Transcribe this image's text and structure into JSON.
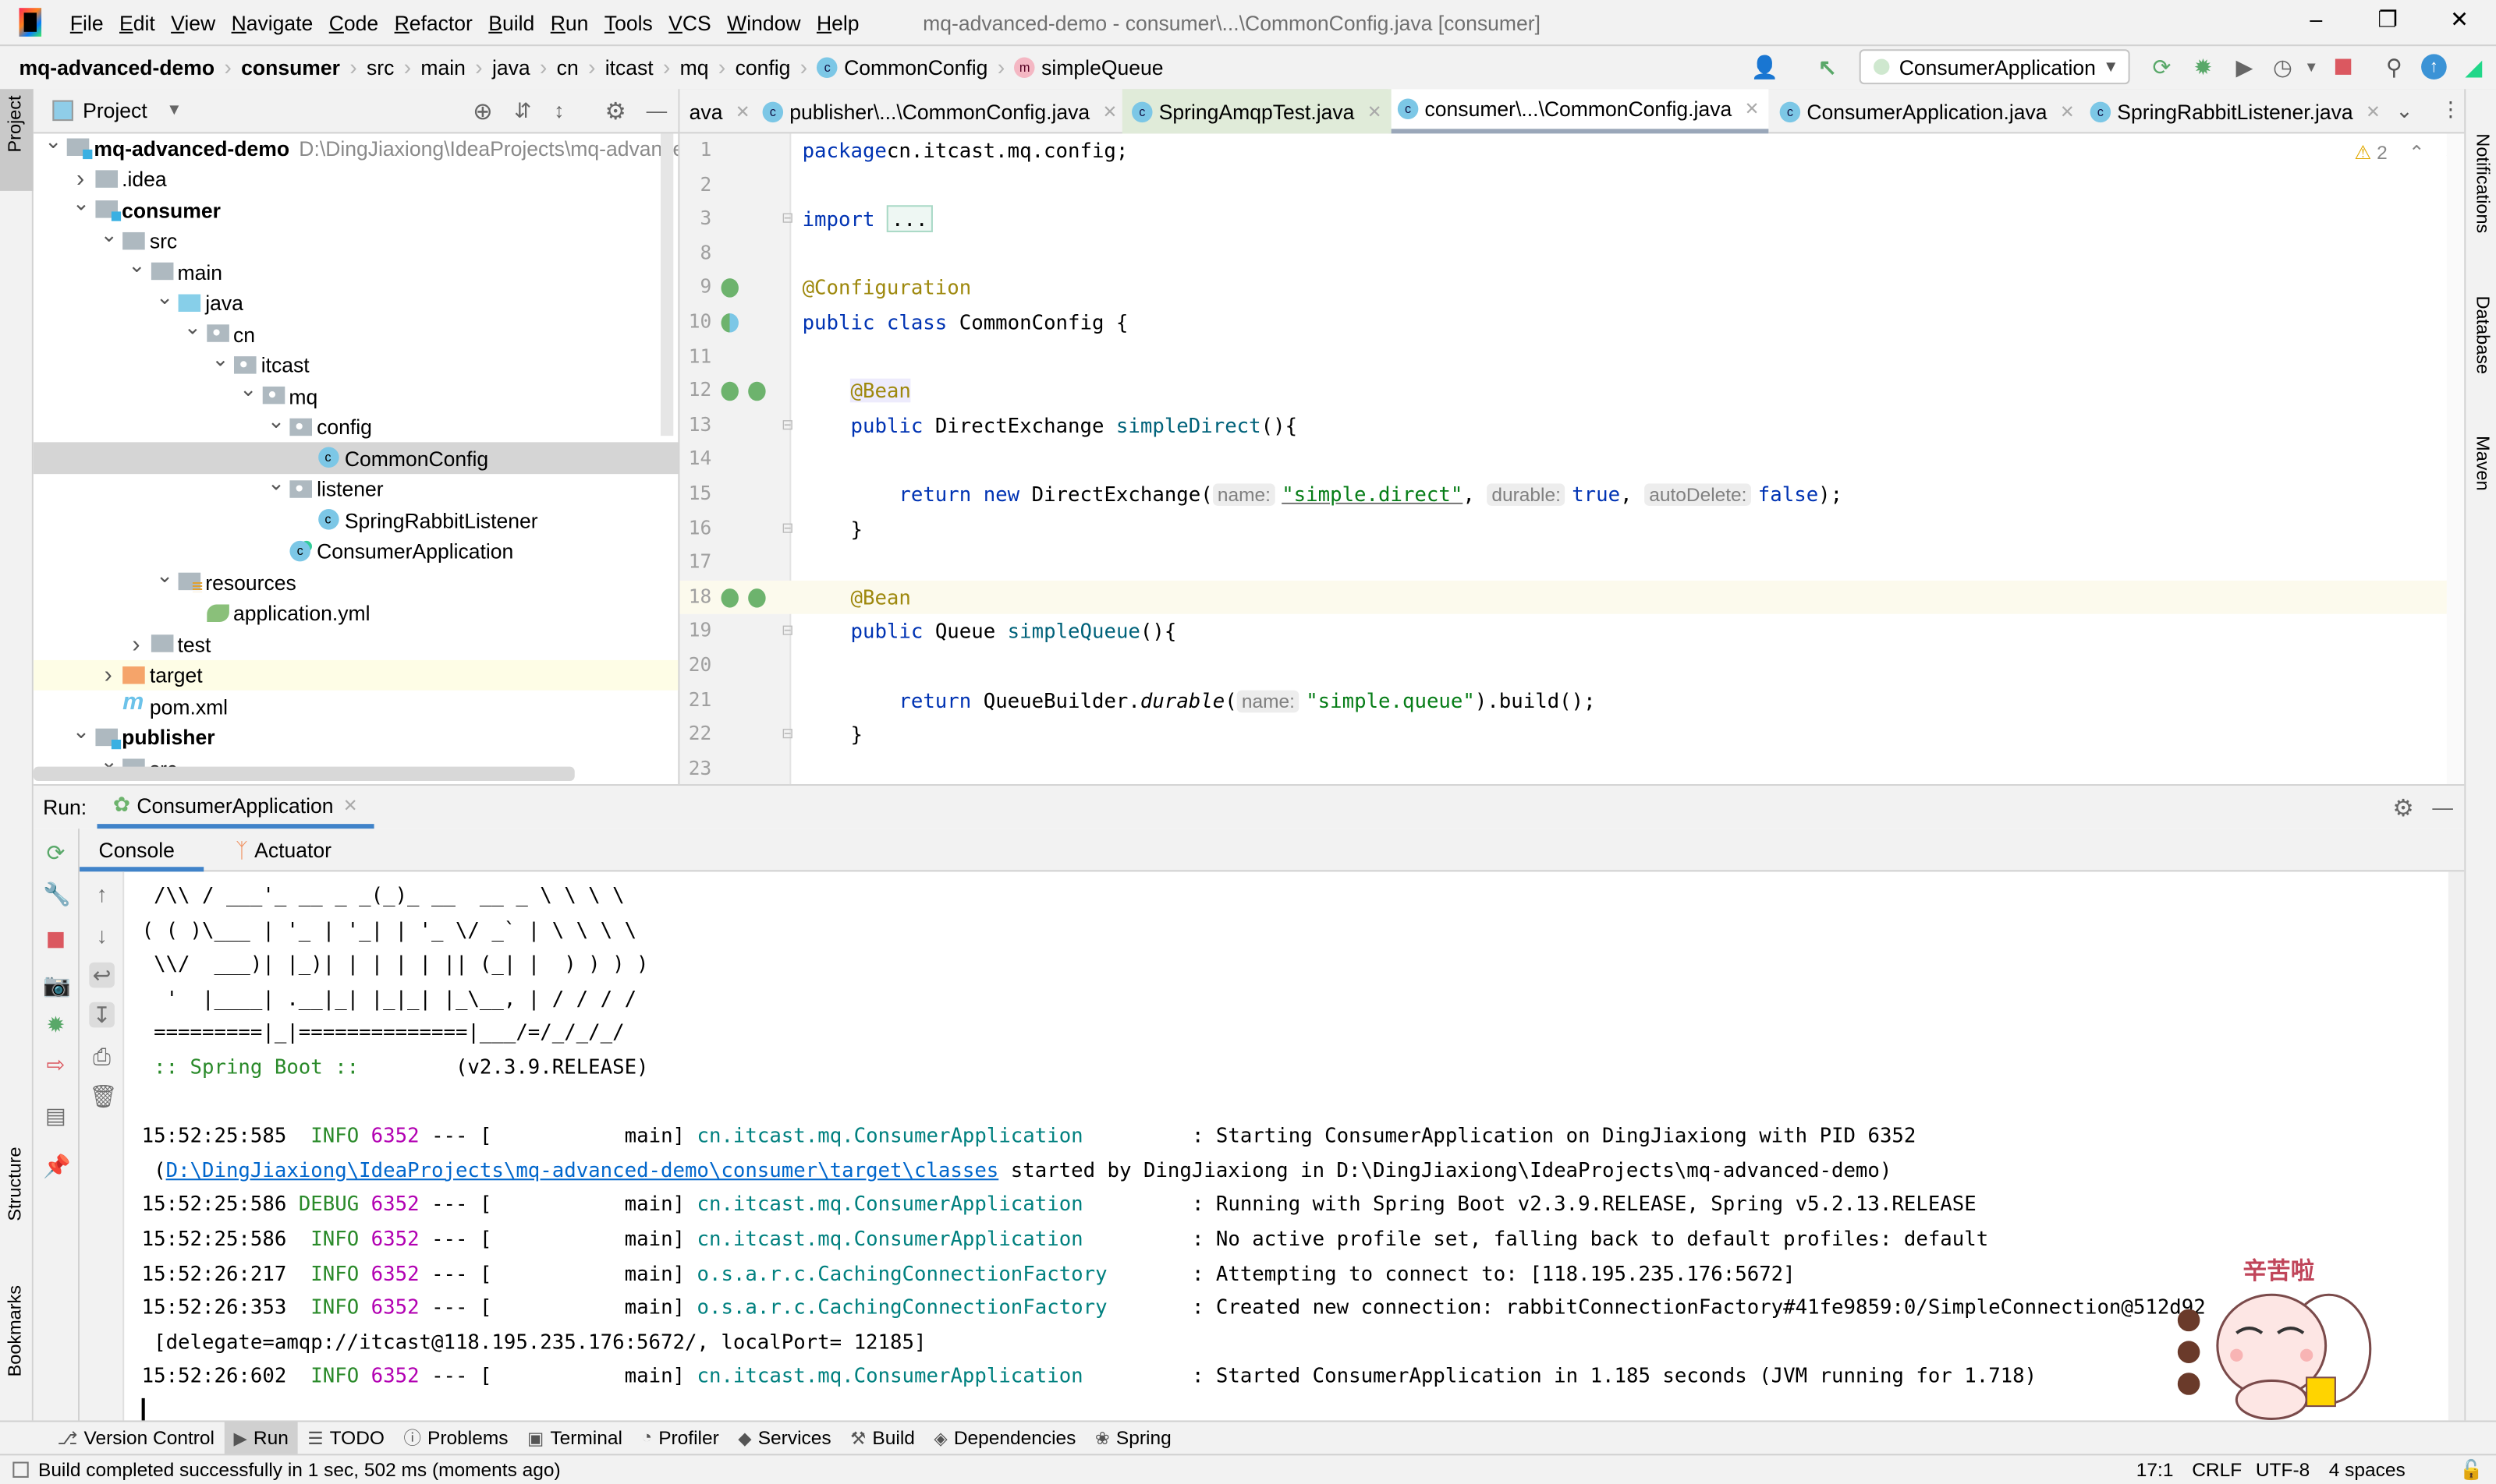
{
  "menu": {
    "items": [
      "File",
      "Edit",
      "View",
      "Navigate",
      "Code",
      "Refactor",
      "Build",
      "Run",
      "Tools",
      "VCS",
      "Window",
      "Help"
    ],
    "window_title": "mq-advanced-demo - consumer\\...\\CommonConfig.java [consumer]"
  },
  "breadcrumb": {
    "items": [
      "mq-advanced-demo",
      "consumer",
      "src",
      "main",
      "java",
      "cn",
      "itcast",
      "mq",
      "config"
    ],
    "class_item": "CommonConfig",
    "method_item": "simpleQueue"
  },
  "toolbar": {
    "run_config": "ConsumerApplication",
    "colors": {
      "stop": "#db5860",
      "run": "#59a869"
    }
  },
  "project": {
    "title": "Project",
    "tree": [
      {
        "label": "mq-advanced-demo",
        "path": "D:\\DingJiaxiong\\IdeaProjects\\mq-advanced-demo",
        "level": 0,
        "arrow": "expanded",
        "icon": "module",
        "bold": true
      },
      {
        "label": ".idea",
        "level": 1,
        "arrow": "collapsed",
        "icon": "folder"
      },
      {
        "label": "consumer",
        "level": 1,
        "arrow": "expanded",
        "icon": "module",
        "bold": true
      },
      {
        "label": "src",
        "level": 2,
        "arrow": "expanded",
        "icon": "folder"
      },
      {
        "label": "main",
        "level": 3,
        "arrow": "expanded",
        "icon": "folder"
      },
      {
        "label": "java",
        "level": 4,
        "arrow": "expanded",
        "icon": "java"
      },
      {
        "label": "cn",
        "level": 5,
        "arrow": "expanded",
        "icon": "pkg"
      },
      {
        "label": "itcast",
        "level": 6,
        "arrow": "expanded",
        "icon": "pkg"
      },
      {
        "label": "mq",
        "level": 7,
        "arrow": "expanded",
        "icon": "pkg"
      },
      {
        "label": "config",
        "level": 8,
        "arrow": "expanded",
        "icon": "pkg"
      },
      {
        "label": "CommonConfig",
        "level": 9,
        "arrow": "none",
        "icon": "class",
        "selected": true
      },
      {
        "label": "listener",
        "level": 8,
        "arrow": "expanded",
        "icon": "pkg"
      },
      {
        "label": "SpringRabbitListener",
        "level": 9,
        "arrow": "none",
        "icon": "class"
      },
      {
        "label": "ConsumerApplication",
        "level": 8,
        "arrow": "none",
        "icon": "spring"
      },
      {
        "label": "resources",
        "level": 4,
        "arrow": "expanded",
        "icon": "res"
      },
      {
        "label": "application.yml",
        "level": 5,
        "arrow": "none",
        "icon": "yml"
      },
      {
        "label": "test",
        "level": 3,
        "arrow": "collapsed",
        "icon": "folder"
      },
      {
        "label": "target",
        "level": 2,
        "arrow": "collapsed",
        "icon": "target",
        "highlight": true
      },
      {
        "label": "pom.xml",
        "level": 2,
        "arrow": "none",
        "icon": "maven"
      },
      {
        "label": "publisher",
        "level": 1,
        "arrow": "expanded",
        "icon": "module",
        "bold": true
      },
      {
        "label": "src",
        "level": 2,
        "arrow": "expanded",
        "icon": "folder"
      }
    ]
  },
  "editor": {
    "tabs": [
      {
        "label": "ava",
        "icon": "none"
      },
      {
        "label": "publisher\\...\\CommonConfig.java",
        "icon": "class"
      },
      {
        "label": "SpringAmqpTest.java",
        "icon": "test-class",
        "state": "green"
      },
      {
        "label": "consumer\\...\\CommonConfig.java",
        "icon": "class",
        "state": "active"
      },
      {
        "label": "ConsumerApplication.java",
        "icon": "spring-class"
      },
      {
        "label": "SpringRabbitListener.java",
        "icon": "class"
      }
    ],
    "warnings": "2",
    "caret_line": "18",
    "lines": [
      {
        "n": "1",
        "t": [
          [
            "kw",
            "package"
          ],
          [
            "",
            "cn.itcast.mq.config;"
          ]
        ]
      },
      {
        "n": "2",
        "t": []
      },
      {
        "n": "3",
        "t": [
          [
            "kw",
            "import "
          ],
          [
            "fold",
            "..."
          ]
        ],
        "fold": true
      },
      {
        "n": "8",
        "t": []
      },
      {
        "n": "9",
        "t": [
          [
            "ann",
            "@Configuration"
          ]
        ],
        "gutter": [
          "bean"
        ]
      },
      {
        "n": "10",
        "t": [
          [
            "kw",
            "public class "
          ],
          [
            "",
            "CommonConfig {"
          ]
        ],
        "gutter": [
          "class"
        ]
      },
      {
        "n": "11",
        "t": []
      },
      {
        "n": "12",
        "t": [
          [
            "",
            "    "
          ],
          [
            "ann annbg",
            "@Bean"
          ]
        ],
        "gutter": [
          "bean",
          "bean"
        ]
      },
      {
        "n": "13",
        "t": [
          [
            "",
            "    "
          ],
          [
            "kw",
            "public "
          ],
          [
            "",
            "DirectExchange "
          ],
          [
            "fn",
            "simpleDirect"
          ],
          [
            "",
            "(){"
          ]
        ],
        "fold": true
      },
      {
        "n": "14",
        "t": []
      },
      {
        "n": "15",
        "t": [
          [
            "",
            "        "
          ],
          [
            "kw",
            "return new "
          ],
          [
            "",
            "DirectExchange("
          ],
          [
            "hint",
            "name:"
          ],
          [
            "str ul",
            "\"simple.direct\""
          ],
          [
            "",
            ", "
          ],
          [
            "hint",
            "durable:"
          ],
          [
            "kw",
            "true"
          ],
          [
            "",
            ", "
          ],
          [
            "hint",
            "autoDelete:"
          ],
          [
            "kw",
            "false"
          ],
          [
            "",
            ");"
          ]
        ]
      },
      {
        "n": "16",
        "t": [
          [
            "",
            "    }"
          ]
        ],
        "fold": true
      },
      {
        "n": "17",
        "t": []
      },
      {
        "n": "18",
        "t": [
          [
            "",
            "    "
          ],
          [
            "ann",
            "@Bean"
          ]
        ],
        "gutter": [
          "bean",
          "bean"
        ]
      },
      {
        "n": "19",
        "t": [
          [
            "",
            "    "
          ],
          [
            "kw",
            "public "
          ],
          [
            "",
            "Queue "
          ],
          [
            "fn",
            "simpleQueue"
          ],
          [
            "",
            "(){"
          ]
        ],
        "fold": true
      },
      {
        "n": "20",
        "t": []
      },
      {
        "n": "21",
        "t": [
          [
            "",
            "        "
          ],
          [
            "kw",
            "return "
          ],
          [
            "",
            "QueueBuilder."
          ],
          [
            "it",
            "durable"
          ],
          [
            "",
            "("
          ],
          [
            "hint",
            "name:"
          ],
          [
            "str",
            "\"simple.queue\""
          ],
          [
            "",
            ").build();"
          ]
        ]
      },
      {
        "n": "22",
        "t": [
          [
            "",
            "    }"
          ]
        ],
        "fold": true
      },
      {
        "n": "23",
        "t": []
      }
    ]
  },
  "run": {
    "label": "Run:",
    "tab": "ConsumerApplication",
    "console_tabs": [
      "Console",
      "Actuator"
    ],
    "banner": [
      " /\\\\ / ___'_ __ _ _(_)_ __  __ _ \\ \\ \\ \\",
      "( ( )\\___ | '_ | '_| | '_ \\/ _` | \\ \\ \\ \\",
      " \\\\/  ___)| |_)| | | | | || (_| |  ) ) ) )",
      "  '  |____| .__|_| |_|_| |_\\__, | / / / /",
      " =========|_|==============|___/=/_/_/_/"
    ],
    "boot_label": " :: Spring Boot :: ",
    "boot_version": "       (v2.3.9.RELEASE)",
    "separator": "---",
    "logs": [
      {
        "time": "15:52:25:585",
        "level": "INFO",
        "pid": "6352",
        "thread": "main",
        "logger": "cn.itcast.mq.ConsumerApplication",
        "msg": "Starting ConsumerApplication on DingJiaxiong with PID 6352",
        "cont": {
          "prefix": " (",
          "link": "D:\\DingJiaxiong\\IdeaProjects\\mq-advanced-demo\\consumer\\target\\classes",
          "suffix": " started by DingJiaxiong in D:\\DingJiaxiong\\IdeaProjects\\mq-advanced-demo)"
        }
      },
      {
        "time": "15:52:25:586",
        "level": "DEBUG",
        "pid": "6352",
        "thread": "main",
        "logger": "cn.itcast.mq.ConsumerApplication",
        "msg": "Running with Spring Boot v2.3.9.RELEASE, Spring v5.2.13.RELEASE"
      },
      {
        "time": "15:52:25:586",
        "level": "INFO",
        "pid": "6352",
        "thread": "main",
        "logger": "cn.itcast.mq.ConsumerApplication",
        "msg": "No active profile set, falling back to default profiles: default"
      },
      {
        "time": "15:52:26:217",
        "level": "INFO",
        "pid": "6352",
        "thread": "main",
        "logger": "o.s.a.r.c.CachingConnectionFactory",
        "msg": "Attempting to connect to: [118.195.235.176:5672]"
      },
      {
        "time": "15:52:26:353",
        "level": "INFO",
        "pid": "6352",
        "thread": "main",
        "logger": "o.s.a.r.c.CachingConnectionFactory",
        "msg": "Created new connection: rabbitConnectionFactory#41fe9859:0/SimpleConnection@512d92",
        "cont": {
          "prefix": " [delegate=amqp://itcast@118.195.235.176:5672/, localPort= 12185]",
          "link": "",
          "suffix": ""
        }
      },
      {
        "time": "15:52:26:602",
        "level": "INFO",
        "pid": "6352",
        "thread": "main",
        "logger": "cn.itcast.mq.ConsumerApplication",
        "msg": "Started ConsumerApplication in 1.185 seconds (JVM running for 1.718)"
      }
    ],
    "colors": {
      "level": "#2a8a2a",
      "pid": "#b200b2",
      "logger": "#00807f",
      "link": "#0066cc"
    }
  },
  "sticker": {
    "caption": "辛苦啦"
  },
  "side": {
    "left_top": "Project",
    "left_mid": "Structure",
    "left_bottom": "Bookmarks",
    "right": [
      "Notifications",
      "Database",
      "Maven"
    ]
  },
  "bottom_tools": [
    {
      "label": "Version Control",
      "icon": "branch"
    },
    {
      "label": "Run",
      "icon": "run",
      "active": true
    },
    {
      "label": "TODO",
      "icon": "list"
    },
    {
      "label": "Problems",
      "icon": "problems"
    },
    {
      "label": "Terminal",
      "icon": "terminal"
    },
    {
      "label": "Profiler",
      "icon": "profiler"
    },
    {
      "label": "Services",
      "icon": "services"
    },
    {
      "label": "Build",
      "icon": "hammer"
    },
    {
      "label": "Dependencies",
      "icon": "dependencies"
    },
    {
      "label": "Spring",
      "icon": "spring"
    }
  ],
  "status": {
    "message": "Build completed successfully in 1 sec, 502 ms (moments ago)",
    "position": "17:1",
    "line_sep": "CRLF",
    "encoding": "UTF-8",
    "indent": "4 spaces"
  }
}
